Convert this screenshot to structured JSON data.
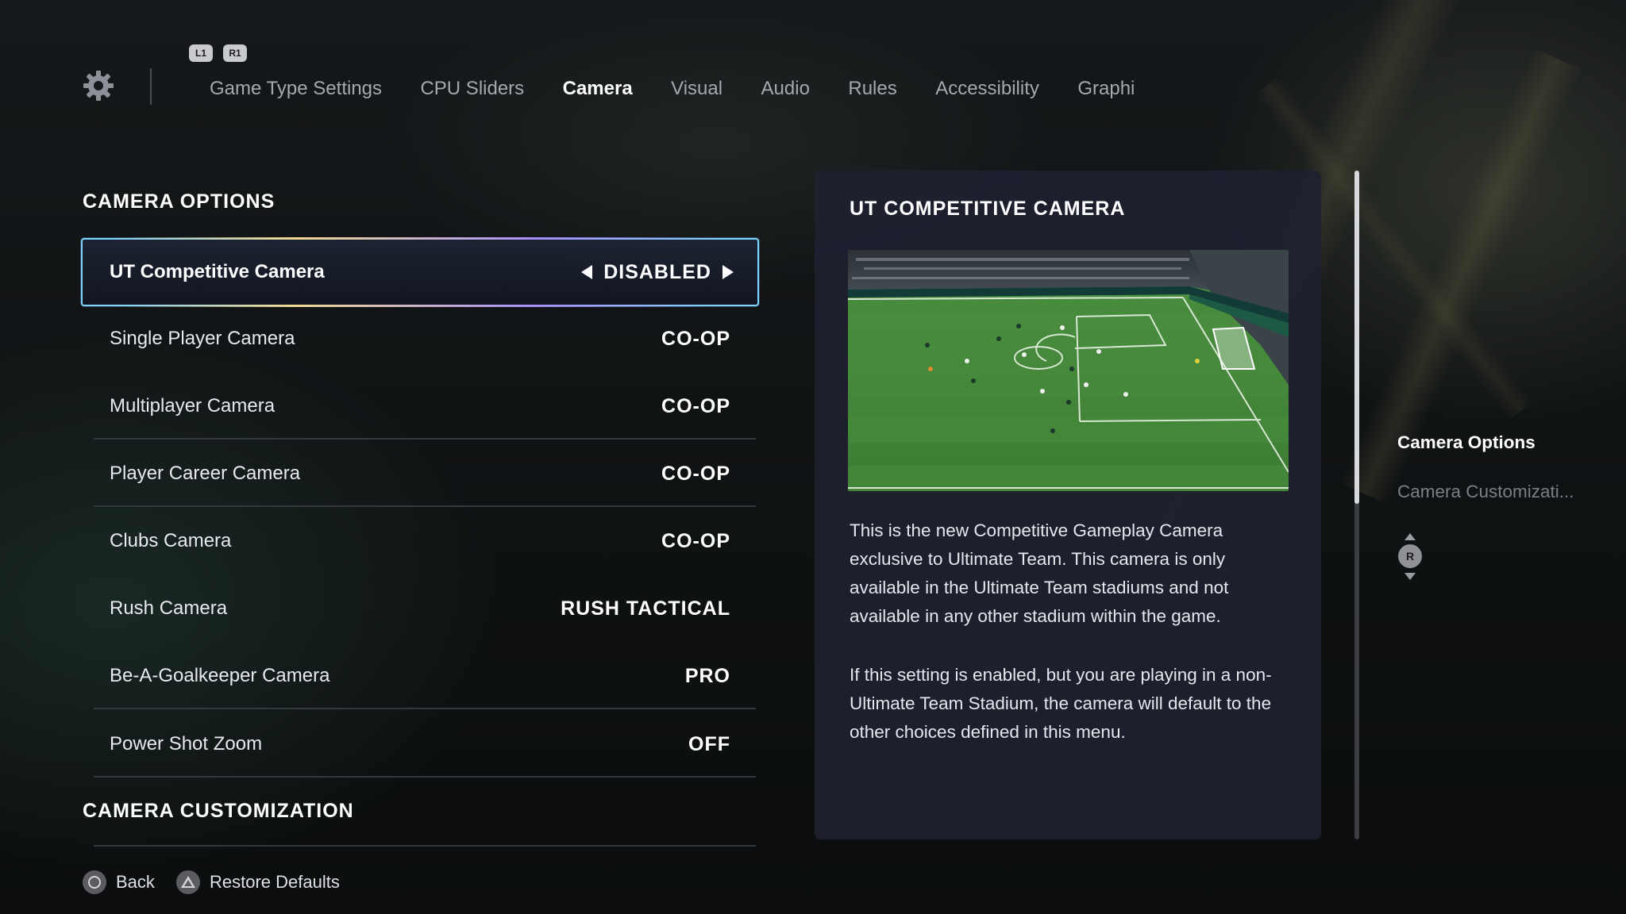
{
  "nav": {
    "shoulder_left": "L1",
    "shoulder_right": "R1",
    "tabs": [
      {
        "label": "Game Type Settings",
        "active": false
      },
      {
        "label": "CPU Sliders",
        "active": false
      },
      {
        "label": "Camera",
        "active": true
      },
      {
        "label": "Visual",
        "active": false
      },
      {
        "label": "Audio",
        "active": false
      },
      {
        "label": "Rules",
        "active": false
      },
      {
        "label": "Accessibility",
        "active": false
      },
      {
        "label": "Graphic",
        "active": false
      }
    ],
    "icon": "gear-icon"
  },
  "camera_options": {
    "title": "CAMERA OPTIONS",
    "rows": [
      {
        "label": "UT Competitive Camera",
        "value": "DISABLED",
        "selected": true
      },
      {
        "label": "Single Player Camera",
        "value": "CO-OP"
      },
      {
        "label": "Multiplayer Camera",
        "value": "CO-OP"
      },
      {
        "label": "Player Career Camera",
        "value": "CO-OP"
      },
      {
        "label": "Clubs Camera",
        "value": "CO-OP"
      },
      {
        "label": "Rush Camera",
        "value": "RUSH TACTICAL"
      },
      {
        "label": "Be-A-Goalkeeper Camera",
        "value": "PRO"
      },
      {
        "label": "Power Shot Zoom",
        "value": "OFF"
      }
    ]
  },
  "camera_customization": {
    "title": "CAMERA CUSTOMIZATION"
  },
  "footer": {
    "back": "Back",
    "restore": "Restore Defaults"
  },
  "info": {
    "title": "UT COMPETITIVE CAMERA",
    "paragraph1": "This is the new Competitive Gameplay Camera exclusive to Ultimate Team. This camera is only available in the Ultimate Team stadiums and not available in any other stadium within the game.",
    "paragraph2": "If this setting is enabled, but you are playing in a non-Ultimate Team Stadium, the camera will default to the other choices defined in this menu."
  },
  "sidebar": {
    "items": [
      {
        "label": "Camera Options",
        "active": true
      },
      {
        "label": "Camera Customizati...",
        "active": false
      }
    ],
    "stick_label": "R"
  },
  "colors": {
    "accent": "#7fd3ff",
    "panel": "#202130",
    "pitch": "#3f8a3a"
  }
}
